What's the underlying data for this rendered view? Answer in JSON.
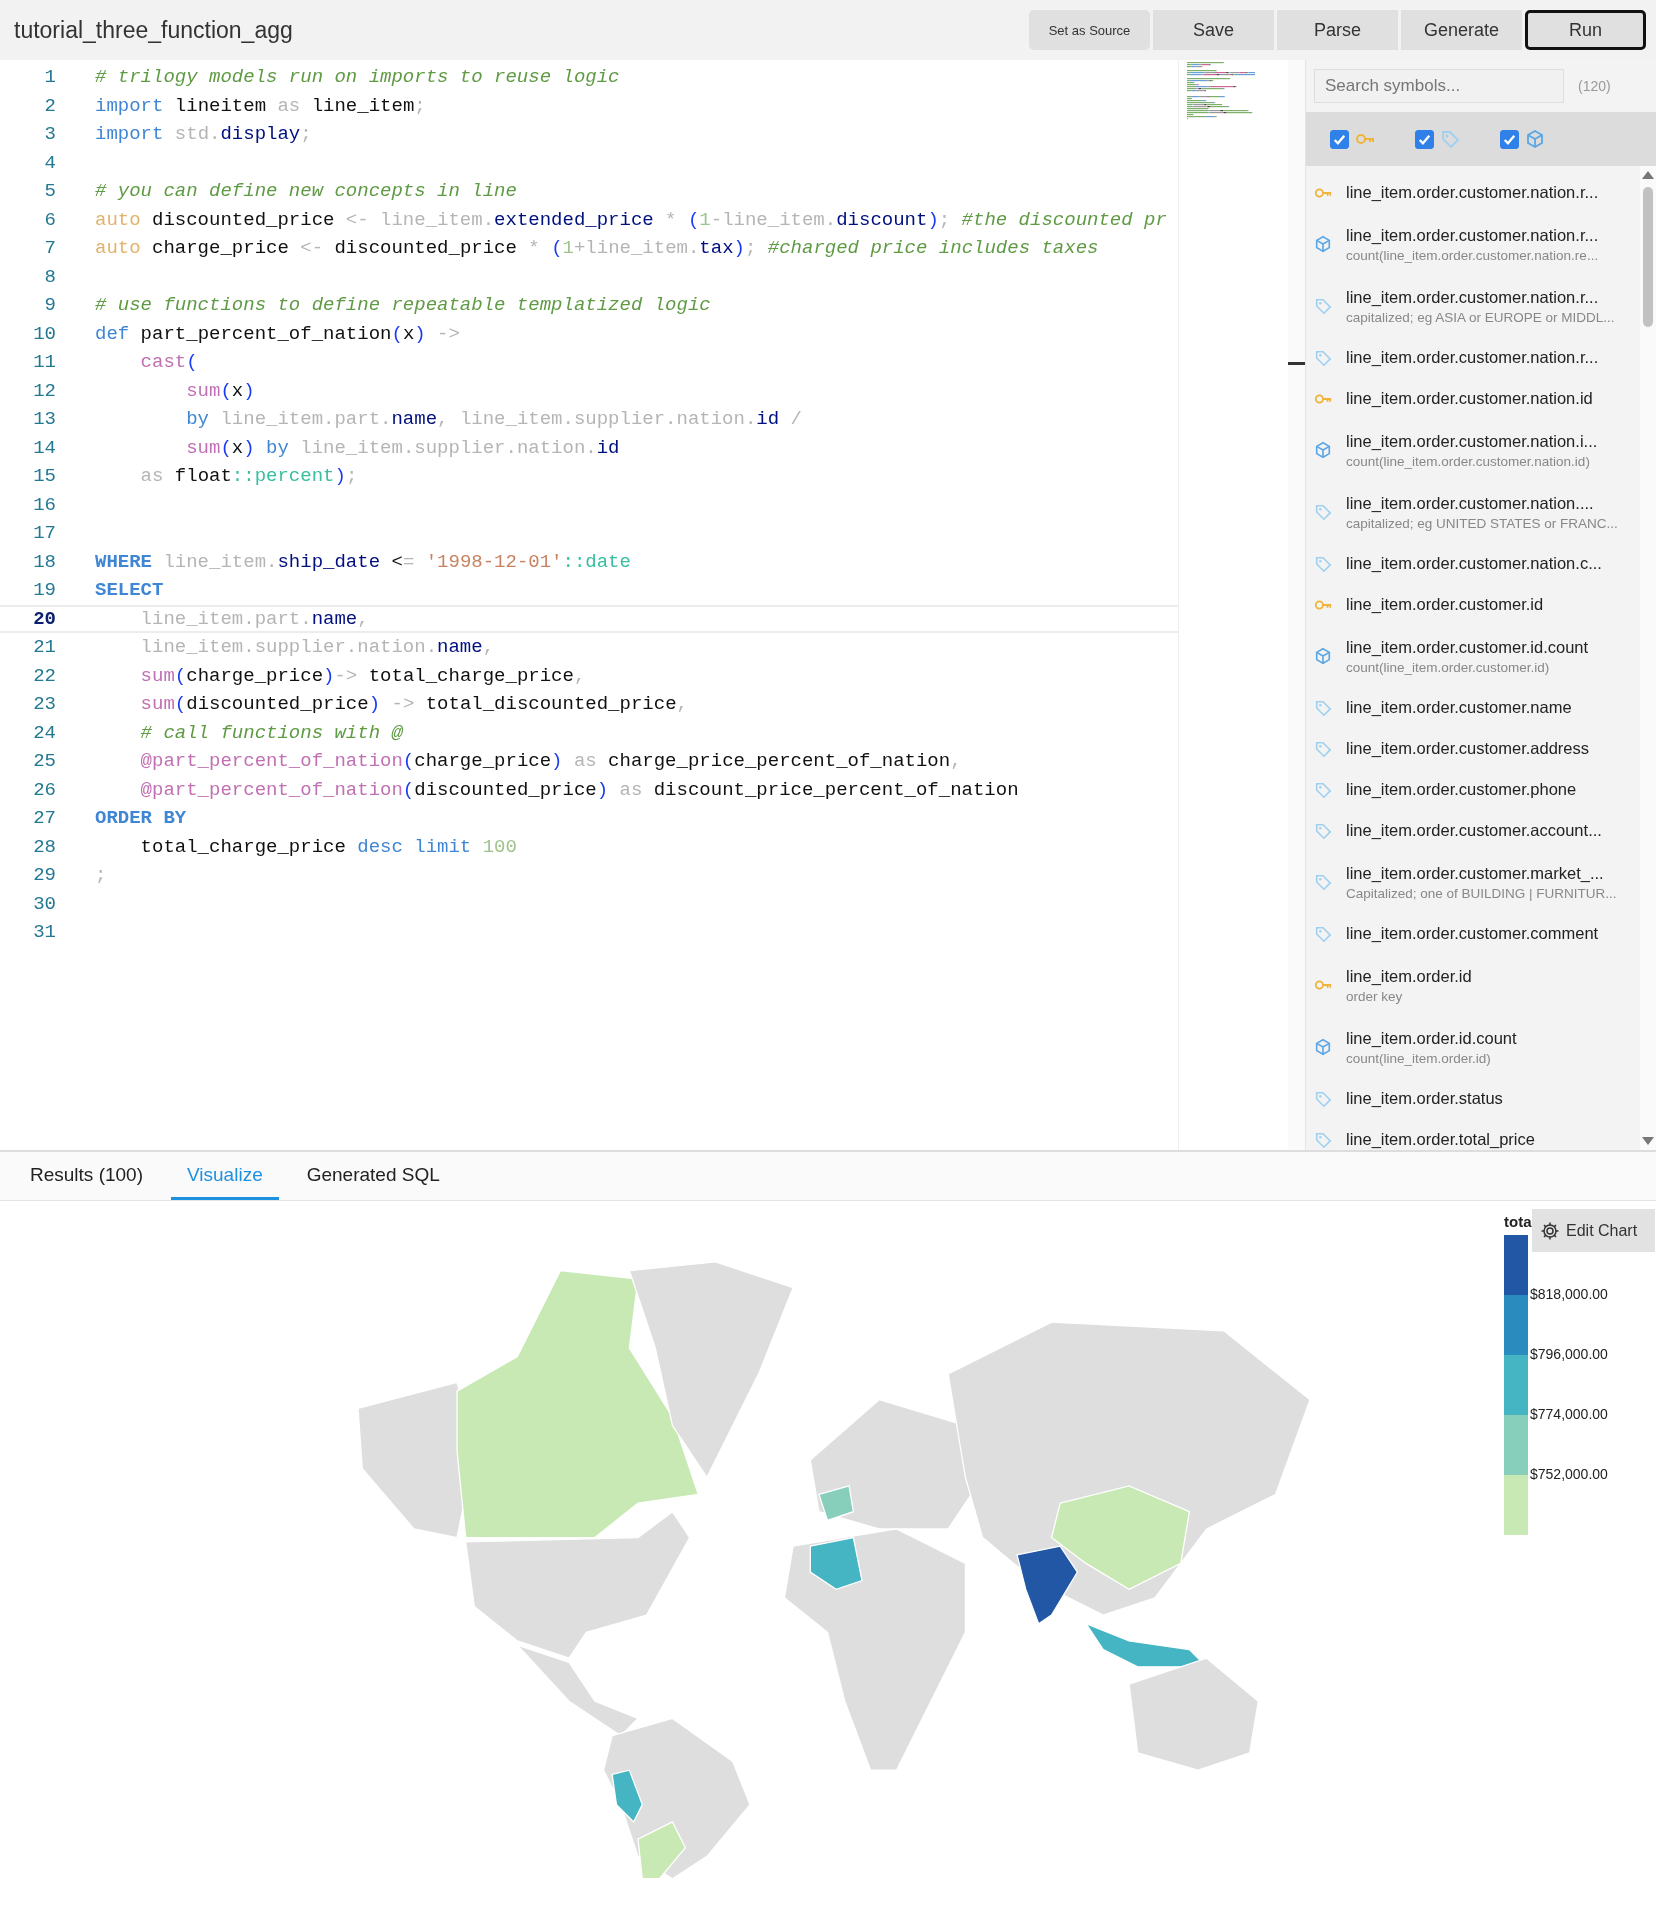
{
  "window": {
    "title": "tutorial_three_function_agg"
  },
  "toolbar": [
    {
      "label": "Set as Source",
      "kind": "small"
    },
    {
      "label": "Save",
      "kind": "plain"
    },
    {
      "label": "Parse",
      "kind": "plain"
    },
    {
      "label": "Generate",
      "kind": "plain"
    },
    {
      "label": "Run",
      "kind": "primary"
    }
  ],
  "editor": {
    "lines": [
      {
        "number": "1",
        "current": false,
        "tokens": [
          {
            "kind": "com",
            "text": "# trilogy models run on imports to reuse logic"
          }
        ]
      },
      {
        "number": "2",
        "current": false,
        "tokens": [
          {
            "kind": "kw",
            "text": "import"
          },
          {
            "kind": "id",
            "text": " lineitem "
          },
          {
            "kind": "dim",
            "text": "as"
          },
          {
            "kind": "id",
            "text": " line_item"
          },
          {
            "kind": "dim",
            "text": ";"
          }
        ]
      },
      {
        "number": "3",
        "current": false,
        "tokens": [
          {
            "kind": "kw",
            "text": "import"
          },
          {
            "kind": "dim",
            "text": " std."
          },
          {
            "kind": "prop",
            "text": "display"
          },
          {
            "kind": "dim",
            "text": ";"
          }
        ]
      },
      {
        "number": "4",
        "current": false
      },
      {
        "number": "5",
        "current": false,
        "tokens": [
          {
            "kind": "com",
            "text": "# you can define new concepts in line"
          }
        ]
      },
      {
        "number": "6",
        "current": false,
        "tokens": [
          {
            "kind": "auto",
            "text": "auto"
          },
          {
            "kind": "id",
            "text": " discounted_price "
          },
          {
            "kind": "dim",
            "text": "<- line_item."
          },
          {
            "kind": "prop",
            "text": "extended_price"
          },
          {
            "kind": "dim",
            "text": " * "
          },
          {
            "kind": "paren",
            "text": "("
          },
          {
            "kind": "num",
            "text": "1"
          },
          {
            "kind": "dim",
            "text": "-line_item."
          },
          {
            "kind": "prop",
            "text": "discount"
          },
          {
            "kind": "paren",
            "text": ")"
          },
          {
            "kind": "dim",
            "text": "; "
          },
          {
            "kind": "com",
            "text": "#the discounted pr"
          }
        ]
      },
      {
        "number": "7",
        "current": false,
        "tokens": [
          {
            "kind": "auto",
            "text": "auto"
          },
          {
            "kind": "id",
            "text": " charge_price "
          },
          {
            "kind": "dim",
            "text": "<- "
          },
          {
            "kind": "id",
            "text": "discounted_price"
          },
          {
            "kind": "dim",
            "text": " * "
          },
          {
            "kind": "paren",
            "text": "("
          },
          {
            "kind": "num",
            "text": "1"
          },
          {
            "kind": "dim",
            "text": "+line_item."
          },
          {
            "kind": "prop",
            "text": "tax"
          },
          {
            "kind": "paren",
            "text": ")"
          },
          {
            "kind": "dim",
            "text": "; "
          },
          {
            "kind": "com",
            "text": "#charged price includes taxes"
          }
        ]
      },
      {
        "number": "8",
        "current": false
      },
      {
        "number": "9",
        "current": false,
        "tokens": [
          {
            "kind": "com",
            "text": "# use functions to define repeatable templatized logic"
          }
        ]
      },
      {
        "number": "10",
        "current": false,
        "tokens": [
          {
            "kind": "kw",
            "text": "def"
          },
          {
            "kind": "id",
            "text": " part_percent_of_nation"
          },
          {
            "kind": "paren",
            "text": "("
          },
          {
            "kind": "id",
            "text": "x"
          },
          {
            "kind": "paren",
            "text": ")"
          },
          {
            "kind": "dim",
            "text": " ->"
          }
        ]
      },
      {
        "number": "11",
        "current": false,
        "tokens": [
          {
            "kind": "fn",
            "text": "    cast"
          },
          {
            "kind": "paren",
            "text": "("
          }
        ]
      },
      {
        "number": "12",
        "current": false,
        "tokens": [
          {
            "kind": "fn",
            "text": "        sum"
          },
          {
            "kind": "paren",
            "text": "("
          },
          {
            "kind": "id",
            "text": "x"
          },
          {
            "kind": "paren",
            "text": ")"
          }
        ]
      },
      {
        "number": "13",
        "current": false,
        "tokens": [
          {
            "kind": "kw",
            "text": "        by"
          },
          {
            "kind": "dim",
            "text": " line_item.part."
          },
          {
            "kind": "prop",
            "text": "name"
          },
          {
            "kind": "dim",
            "text": ", line_item.supplier.nation."
          },
          {
            "kind": "prop",
            "text": "id"
          },
          {
            "kind": "dim",
            "text": " /"
          }
        ]
      },
      {
        "number": "14",
        "current": false,
        "tokens": [
          {
            "kind": "fn",
            "text": "        sum"
          },
          {
            "kind": "paren",
            "text": "("
          },
          {
            "kind": "id",
            "text": "x"
          },
          {
            "kind": "paren",
            "text": ")"
          },
          {
            "kind": "kw",
            "text": " by"
          },
          {
            "kind": "dim",
            "text": " line_item.supplier.nation."
          },
          {
            "kind": "prop",
            "text": "id"
          }
        ]
      },
      {
        "number": "15",
        "current": false,
        "tokens": [
          {
            "kind": "dim",
            "text": "    as"
          },
          {
            "kind": "id",
            "text": " float"
          },
          {
            "kind": "type",
            "text": "::percent"
          },
          {
            "kind": "paren",
            "text": ")"
          },
          {
            "kind": "dim",
            "text": ";"
          }
        ]
      },
      {
        "number": "16",
        "current": false
      },
      {
        "number": "17",
        "current": false
      },
      {
        "number": "18",
        "current": false,
        "tokens": [
          {
            "kind": "kwb",
            "text": "WHERE"
          },
          {
            "kind": "dim",
            "text": " line_item."
          },
          {
            "kind": "prop",
            "text": "ship_date"
          },
          {
            "kind": "id",
            "text": " <"
          },
          {
            "kind": "dim",
            "text": "="
          },
          {
            "kind": "str",
            "text": " '1998-12-01'"
          },
          {
            "kind": "type",
            "text": "::date"
          }
        ]
      },
      {
        "number": "19",
        "current": false,
        "tokens": [
          {
            "kind": "kwb",
            "text": "SELECT"
          }
        ]
      },
      {
        "number": "20",
        "current": true,
        "tokens": [
          {
            "kind": "dim",
            "text": "    line_item.part."
          },
          {
            "kind": "prop",
            "text": "name"
          },
          {
            "kind": "dim",
            "text": ","
          }
        ]
      },
      {
        "number": "21",
        "current": false,
        "tokens": [
          {
            "kind": "dim",
            "text": "    line_item.supplier.nation."
          },
          {
            "kind": "prop",
            "text": "name"
          },
          {
            "kind": "dim",
            "text": ","
          }
        ]
      },
      {
        "number": "22",
        "current": false,
        "tokens": [
          {
            "kind": "fn",
            "text": "    sum"
          },
          {
            "kind": "paren",
            "text": "("
          },
          {
            "kind": "id",
            "text": "charge_price"
          },
          {
            "kind": "paren",
            "text": ")"
          },
          {
            "kind": "dim",
            "text": "-> "
          },
          {
            "kind": "id",
            "text": "total_charge_price"
          },
          {
            "kind": "dim",
            "text": ","
          }
        ]
      },
      {
        "number": "23",
        "current": false,
        "tokens": [
          {
            "kind": "fn",
            "text": "    sum"
          },
          {
            "kind": "paren",
            "text": "("
          },
          {
            "kind": "id",
            "text": "discounted_price"
          },
          {
            "kind": "paren",
            "text": ")"
          },
          {
            "kind": "dim",
            "text": " -> "
          },
          {
            "kind": "id",
            "text": "total_discounted_price"
          },
          {
            "kind": "dim",
            "text": ","
          }
        ]
      },
      {
        "number": "24",
        "current": false,
        "tokens": [
          {
            "kind": "com",
            "text": "    # call functions with @"
          }
        ]
      },
      {
        "number": "25",
        "current": false,
        "tokens": [
          {
            "kind": "fn",
            "text": "    @part_percent_of_nation"
          },
          {
            "kind": "paren",
            "text": "("
          },
          {
            "kind": "id",
            "text": "charge_price"
          },
          {
            "kind": "paren",
            "text": ")"
          },
          {
            "kind": "dim",
            "text": " as "
          },
          {
            "kind": "id",
            "text": "charge_price_percent_of_nation"
          },
          {
            "kind": "dim",
            "text": ","
          }
        ]
      },
      {
        "number": "26",
        "current": false,
        "tokens": [
          {
            "kind": "fn",
            "text": "    @part_percent_of_nation"
          },
          {
            "kind": "paren",
            "text": "("
          },
          {
            "kind": "id",
            "text": "discounted_price"
          },
          {
            "kind": "paren",
            "text": ")"
          },
          {
            "kind": "dim",
            "text": " as "
          },
          {
            "kind": "id",
            "text": "discount_price_percent_of_nation"
          }
        ]
      },
      {
        "number": "27",
        "current": false,
        "tokens": [
          {
            "kind": "kwb",
            "text": "ORDER BY"
          }
        ]
      },
      {
        "number": "28",
        "current": false,
        "tokens": [
          {
            "kind": "id",
            "text": "    total_charge_price "
          },
          {
            "kind": "kw",
            "text": "desc limit "
          },
          {
            "kind": "num",
            "text": "100"
          }
        ]
      },
      {
        "number": "29",
        "current": false,
        "tokens": [
          {
            "kind": "dim",
            "text": ";"
          }
        ]
      },
      {
        "number": "30",
        "current": false
      },
      {
        "number": "31",
        "current": false
      }
    ]
  },
  "symbols": {
    "search": {
      "placeholder": "Search symbols..."
    },
    "count": "(120)",
    "filters": [
      {
        "kind": "key",
        "checked": true
      },
      {
        "kind": "tag",
        "checked": true
      },
      {
        "kind": "cube",
        "checked": true
      }
    ],
    "items": [
      {
        "kind": "key",
        "title": "line_item.order.customer.nation.r..."
      },
      {
        "kind": "cube",
        "title": "line_item.order.customer.nation.r...",
        "subtitle": "count(line_item.order.customer.nation.re..."
      },
      {
        "kind": "tag",
        "title": "line_item.order.customer.nation.r...",
        "subtitle": "capitalized; eg ASIA or EUROPE or MIDDL..."
      },
      {
        "kind": "tag",
        "title": "line_item.order.customer.nation.r..."
      },
      {
        "kind": "key",
        "title": "line_item.order.customer.nation.id"
      },
      {
        "kind": "cube",
        "title": "line_item.order.customer.nation.i...",
        "subtitle": "count(line_item.order.customer.nation.id)"
      },
      {
        "kind": "tag",
        "title": "line_item.order.customer.nation....",
        "subtitle": "capitalized; eg UNITED STATES or FRANC..."
      },
      {
        "kind": "tag",
        "title": "line_item.order.customer.nation.c..."
      },
      {
        "kind": "key",
        "title": "line_item.order.customer.id"
      },
      {
        "kind": "cube",
        "title": "line_item.order.customer.id.count",
        "subtitle": "count(line_item.order.customer.id)"
      },
      {
        "kind": "tag",
        "title": "line_item.order.customer.name"
      },
      {
        "kind": "tag",
        "title": "line_item.order.customer.address"
      },
      {
        "kind": "tag",
        "title": "line_item.order.customer.phone"
      },
      {
        "kind": "tag",
        "title": "line_item.order.customer.account..."
      },
      {
        "kind": "tag",
        "title": "line_item.order.customer.market_...",
        "subtitle": "Capitalized; one of BUILDING | FURNITUR..."
      },
      {
        "kind": "tag",
        "title": "line_item.order.customer.comment"
      },
      {
        "kind": "key",
        "title": "line_item.order.id",
        "subtitle": "order key"
      },
      {
        "kind": "cube",
        "title": "line_item.order.id.count",
        "subtitle": "count(line_item.order.id)"
      },
      {
        "kind": "tag",
        "title": "line_item.order.status"
      },
      {
        "kind": "tag",
        "title": "line_item.order.total_price"
      }
    ]
  },
  "results_tabs": [
    {
      "label": "Results (100)",
      "selected": false
    },
    {
      "label": "Visualize",
      "selected": true
    },
    {
      "label": "Generated SQL",
      "selected": false
    }
  ],
  "visualization": {
    "edit_button": "Edit Chart",
    "legend": {
      "title": "tota",
      "steps": [
        {
          "color": "#2257a6"
        },
        {
          "color": "#2a8bbf"
        },
        {
          "color": "#45b4c3"
        },
        {
          "color": "#87cfbb"
        },
        {
          "color": "#c8e9b4"
        }
      ],
      "labels": [
        "$818,000.00",
        "$796,000.00",
        "$774,000.00",
        "$752,000.00"
      ]
    }
  }
}
